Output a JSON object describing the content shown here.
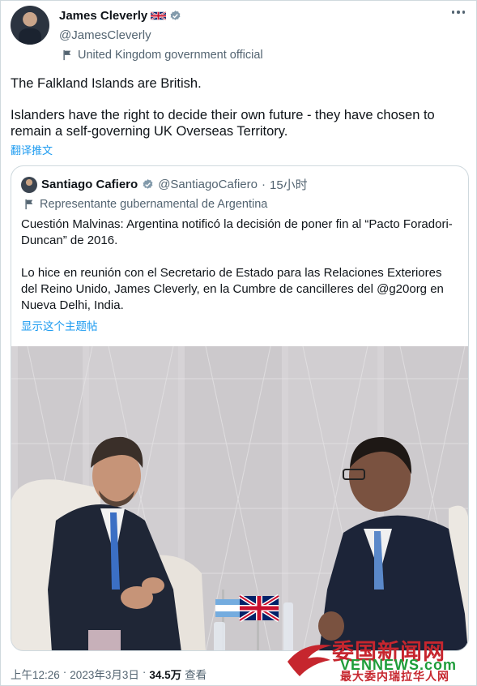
{
  "tweet": {
    "author_name": "James Cleverly",
    "author_handle": "@JamesCleverly",
    "gov_label": "United Kingdom government official",
    "text_line1": "The Falkland Islands are British.",
    "text_line2": "Islanders have the right to decide their own future - they have chosen to remain a self-governing UK Overseas Territory.",
    "translate_label": "翻译推文"
  },
  "quoted": {
    "author_name": "Santiago Cafiero",
    "author_handle": "@SantiagoCafiero",
    "separator": "·",
    "time": "15小时",
    "gov_label": "Representante gubernamental de Argentina",
    "text_para1": "Cuestión Malvinas: Argentina notificó la decisión de poner fin al “Pacto Foradori-Duncan” de 2016.",
    "text_para2": "Lo hice en reunión con el Secretario de Estado para las Relaciones Exteriores del Reino Unido, James Cleverly, en la Cumbre de cancilleres del @g20org en Nueva Delhi, India.",
    "show_thread": "显示这个主题帖"
  },
  "footer": {
    "time": "上午12:26",
    "separator": "·",
    "date": "2023年3月3日",
    "views_count": "34.5万",
    "views_label": "查看"
  },
  "watermark": {
    "title": "委国新闻网",
    "site": "VENNEWS.com",
    "slogan": "最大委内瑞拉华人网"
  },
  "colors": {
    "link": "#1d9bf0",
    "verified": "#829aab",
    "secondary_text": "#536471",
    "border": "#cfd9de"
  },
  "icons": [
    "verified-badge-icon",
    "government-flag-icon",
    "more-options-icon",
    "uk-flag-emoji"
  ]
}
